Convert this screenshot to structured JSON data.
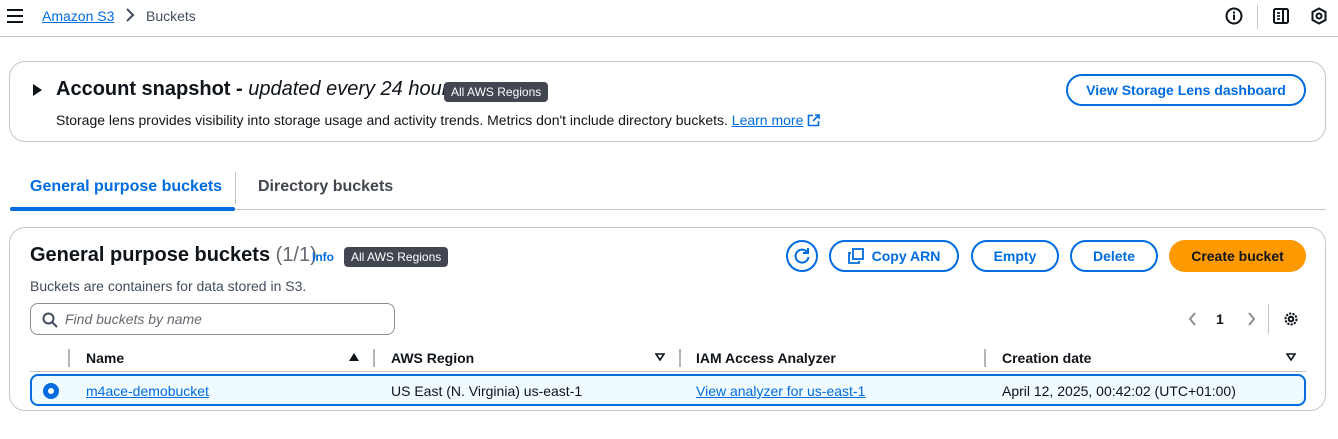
{
  "breadcrumb": {
    "root": "Amazon S3",
    "current": "Buckets"
  },
  "topbar_icons": [
    "info-icon",
    "notifications-panel-icon",
    "settings-shield-icon"
  ],
  "snapshot": {
    "title": "Account snapshot -",
    "title_suffix": "updated every 24 hours",
    "badge": "All AWS Regions",
    "description": "Storage lens provides visibility into storage usage and activity trends. Metrics don't include directory buckets.",
    "learn_more": "Learn more",
    "lens_button": "View Storage Lens dashboard"
  },
  "tabs": {
    "active": "General purpose buckets",
    "inactive": "Directory buckets"
  },
  "buckets": {
    "title": "General purpose buckets",
    "count": "(1/1)",
    "info": "Info",
    "badge": "All AWS Regions",
    "description": "Buckets are containers for data stored in S3.",
    "search_placeholder": "Find buckets by name",
    "buttons": {
      "copy_arn": "Copy ARN",
      "empty": "Empty",
      "delete": "Delete",
      "create": "Create bucket"
    },
    "page": "1",
    "columns": {
      "name": "Name",
      "region": "AWS Region",
      "iam": "IAM Access Analyzer",
      "created": "Creation date"
    },
    "rows": [
      {
        "name": "m4ace-demobucket",
        "region": "US East (N. Virginia) us-east-1",
        "iam": "View analyzer for us-east-1",
        "created": "April 12, 2025, 00:42:02 (UTC+01:00)",
        "selected": true
      }
    ]
  },
  "colors": {
    "accent": "#006ce0",
    "primary_button": "#ff9900",
    "badge_bg": "#424650",
    "selected_row_bg": "#f0fbff"
  }
}
